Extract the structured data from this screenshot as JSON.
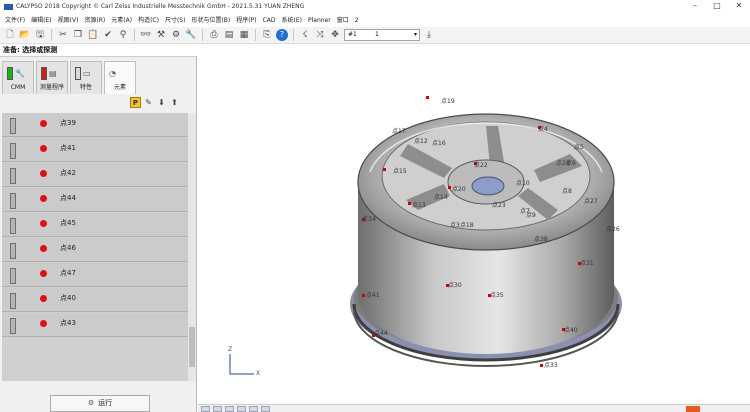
{
  "window": {
    "title": "CALYPSO 2018 Copyright © Carl Zeiss Industrielle Messtechnik GmbH - 2021.5.31  YUAN ZHENG"
  },
  "menu": [
    "文件(F)",
    "编辑(E)",
    "视图(V)",
    "资源(R)",
    "元素(A)",
    "构造(C)",
    "尺寸(S)",
    "形状与位置(B)",
    "程序(P)",
    "CAD",
    "系统(E)",
    "Planner",
    "窗口",
    "2"
  ],
  "toolbar": {
    "selector_value": "#1",
    "selector_value2": "1"
  },
  "status": "准备: 选择或探测",
  "tabs": [
    {
      "label": "CMM",
      "icon": "cmm-icon",
      "color": "#1db21d"
    },
    {
      "label": "测量程序",
      "icon": "program-icon",
      "color": "#d21c1c"
    },
    {
      "label": "特性",
      "icon": "characteristic-icon",
      "color": "#d8d8d8"
    },
    {
      "label": "元素",
      "icon": "element-icon"
    }
  ],
  "list": {
    "items": [
      {
        "label": "点39"
      },
      {
        "label": "点41"
      },
      {
        "label": "点42"
      },
      {
        "label": "点44"
      },
      {
        "label": "点45"
      },
      {
        "label": "点46"
      },
      {
        "label": "点47"
      },
      {
        "label": "点40"
      },
      {
        "label": "点43"
      }
    ]
  },
  "run_button": "运行",
  "viewport": {
    "axis_x": "X",
    "axis_z": "Z",
    "point_labels": [
      "点19",
      "点4",
      "点17",
      "点12",
      "点16",
      "点22",
      "点5",
      "点15",
      "点28",
      "点6",
      "点8",
      "点20",
      "点10",
      "点7",
      "点13",
      "点14",
      "点23",
      "点9",
      "点27",
      "点34",
      "点18",
      "点3",
      "点38",
      "点31",
      "点30",
      "点35",
      "点41",
      "点44",
      "点40",
      "点26",
      "点33"
    ]
  }
}
